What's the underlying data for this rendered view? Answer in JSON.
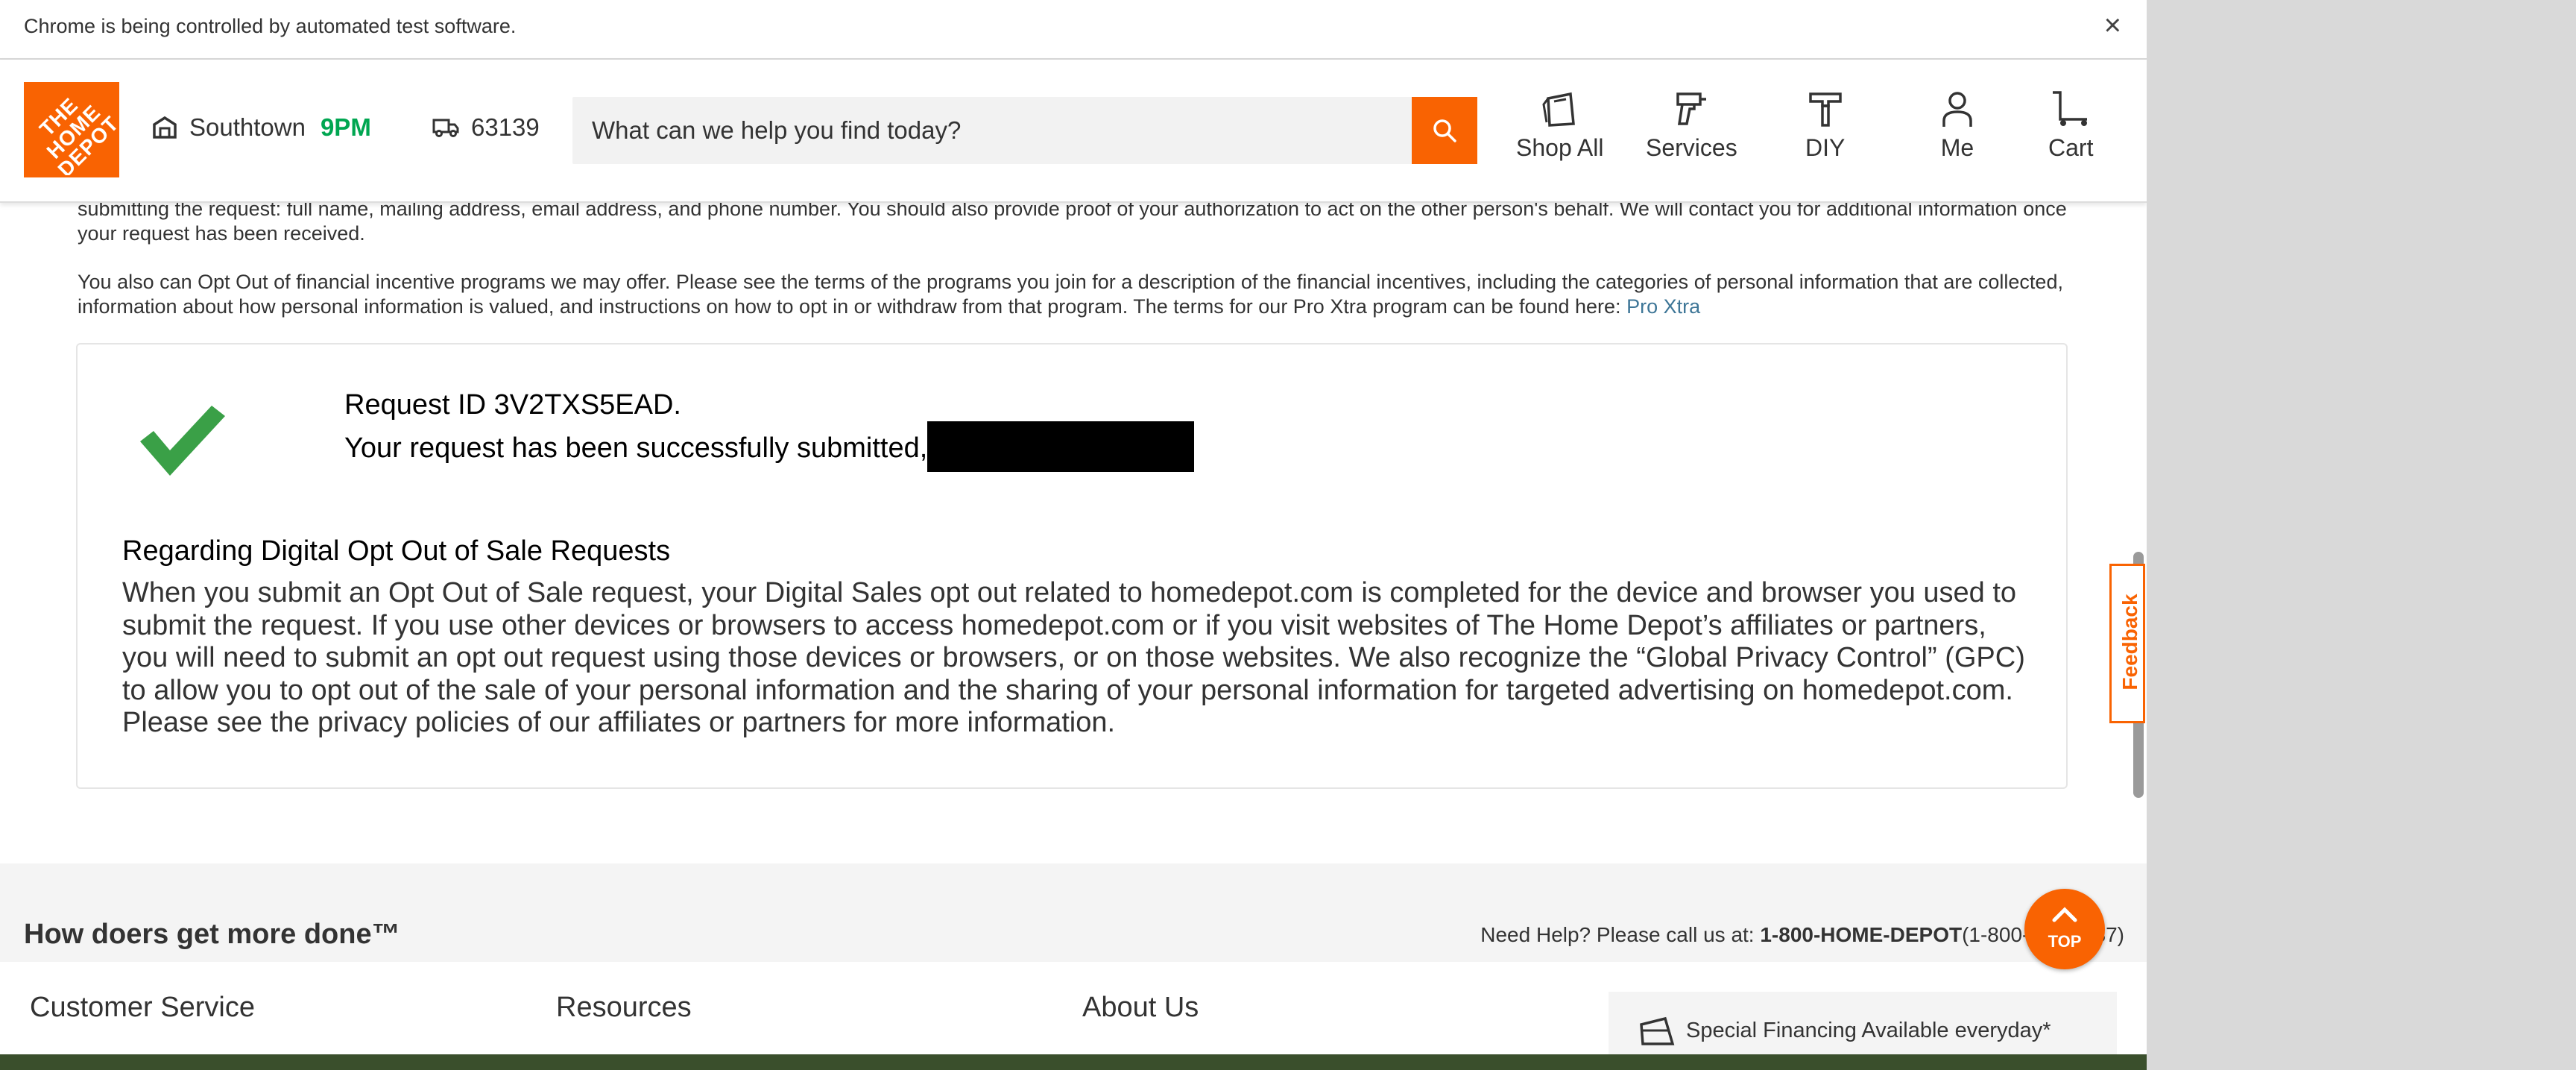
{
  "infobar": {
    "text": "Chrome is being controlled by automated test software.",
    "close": "×"
  },
  "header": {
    "logo_text": "THE HOME DEPOT",
    "store": {
      "name": "Southtown",
      "hours": "9PM"
    },
    "zip": "63139",
    "search": {
      "placeholder": "What can we help you find today?"
    },
    "nav": [
      {
        "label": "Shop All",
        "icon": "shop-all-icon"
      },
      {
        "label": "Services",
        "icon": "services-icon"
      },
      {
        "label": "DIY",
        "icon": "diy-icon"
      },
      {
        "label": "Me",
        "icon": "person-icon"
      },
      {
        "label": "Cart",
        "icon": "cart-icon"
      }
    ]
  },
  "main": {
    "para1": "submitting the request: full name, mailing address, email address, and phone number. You should also provide proof of your authorization to act on the other person's behalf. We will contact you for additional information once your request has been received.",
    "para2": "You also can Opt Out of financial incentive programs we may offer. Please see the terms of the programs you join for a description of the financial incentives, including the categories of personal information that are collected, information about how personal information is valued, and instructions on how to opt in or withdraw from that program. The terms for our Pro Xtra program can be found here: ",
    "para2_link": "Pro Xtra",
    "confirmation": {
      "request_id": "Request ID 3V2TXS5EAD.",
      "message": "Your request has been successfully submitted,",
      "section_title": "Regarding Digital Opt Out of Sale Requests",
      "section_body": "When you submit an Opt Out of Sale request, your Digital Sales opt out related to homedepot.com is completed for the device and browser you used to submit the request. If you use other devices or browsers to access homedepot.com or if you visit websites of The Home Depot’s affiliates or partners, you will need to submit an opt out request using those devices or browsers, or on those websites. We also recognize the “Global Privacy Control” (GPC) to allow you to opt out of the sale of your personal information and the sharing of your personal information for targeted advertising on homedepot.com. Please see the privacy policies of our affiliates or partners for more information."
    }
  },
  "footer": {
    "tagline": "How doers get more done™",
    "help_prefix": "Need Help? Please call us at: ",
    "help_phone": "1-800-HOME-DEPOT",
    "help_suffix": "(1-800-466-3337)",
    "columns": [
      "Customer Service",
      "Resources",
      "About Us"
    ],
    "financing": "Special Financing Available everyday*"
  },
  "top_button": "TOP",
  "feedback": "Feedback",
  "colors": {
    "brand": "#f96302",
    "store_hours": "#00a651",
    "link": "#3e7697",
    "check": "#3aa047"
  }
}
